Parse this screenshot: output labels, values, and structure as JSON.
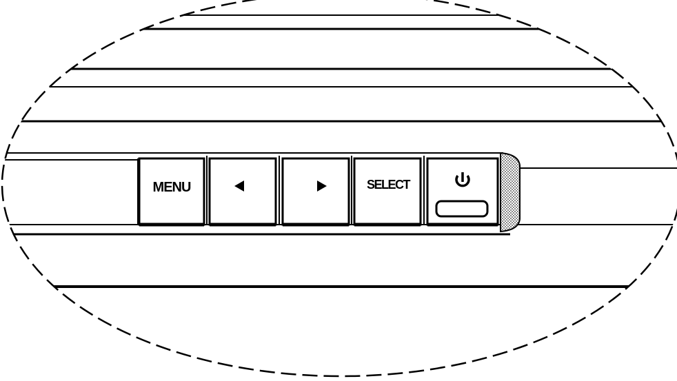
{
  "buttons": [
    {
      "id": "menu",
      "label": "MENU",
      "kind": "text"
    },
    {
      "id": "left",
      "label": "",
      "kind": "arrow-left-icon"
    },
    {
      "id": "right",
      "label": "",
      "kind": "arrow-right-icon"
    },
    {
      "id": "select",
      "label": "SELECT",
      "kind": "text"
    },
    {
      "id": "power",
      "label": "",
      "kind": "power-icon"
    }
  ],
  "colors": {
    "line": "#000000",
    "background": "#ffffff",
    "shadow": "#222222"
  }
}
